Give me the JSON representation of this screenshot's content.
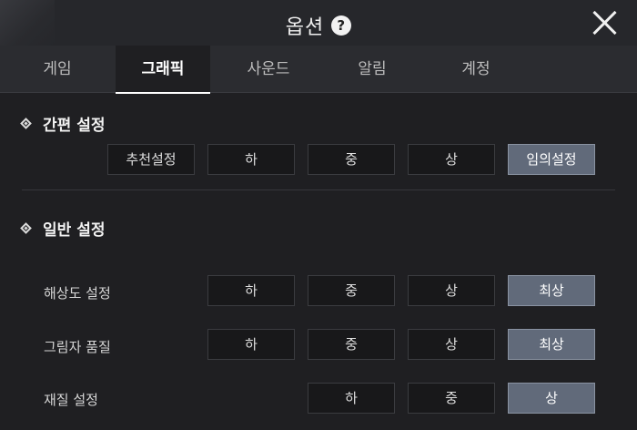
{
  "header": {
    "title": "옵션",
    "help_glyph": "?",
    "close_icon": "close-icon"
  },
  "tabs": [
    {
      "label": "게임",
      "active": false
    },
    {
      "label": "그래픽",
      "active": true
    },
    {
      "label": "사운드",
      "active": false
    },
    {
      "label": "알림",
      "active": false
    },
    {
      "label": "계정",
      "active": false
    }
  ],
  "quick_settings": {
    "title": "간편 설정",
    "options": [
      "추천설정",
      "하",
      "중",
      "상",
      "임의설정"
    ],
    "selected": "임의설정"
  },
  "general_settings": {
    "title": "일반 설정",
    "rows": [
      {
        "label": "해상도 설정",
        "options": [
          "하",
          "중",
          "상",
          "최상"
        ],
        "selected": "최상"
      },
      {
        "label": "그림자 품질",
        "options": [
          "하",
          "중",
          "상",
          "최상"
        ],
        "selected": "최상"
      },
      {
        "label": "재질 설정",
        "options": [
          "하",
          "중",
          "상"
        ],
        "selected": "상"
      }
    ]
  },
  "colors": {
    "background": "#1f1f22",
    "selected_button": "#616a7a",
    "button": "#18181a"
  }
}
